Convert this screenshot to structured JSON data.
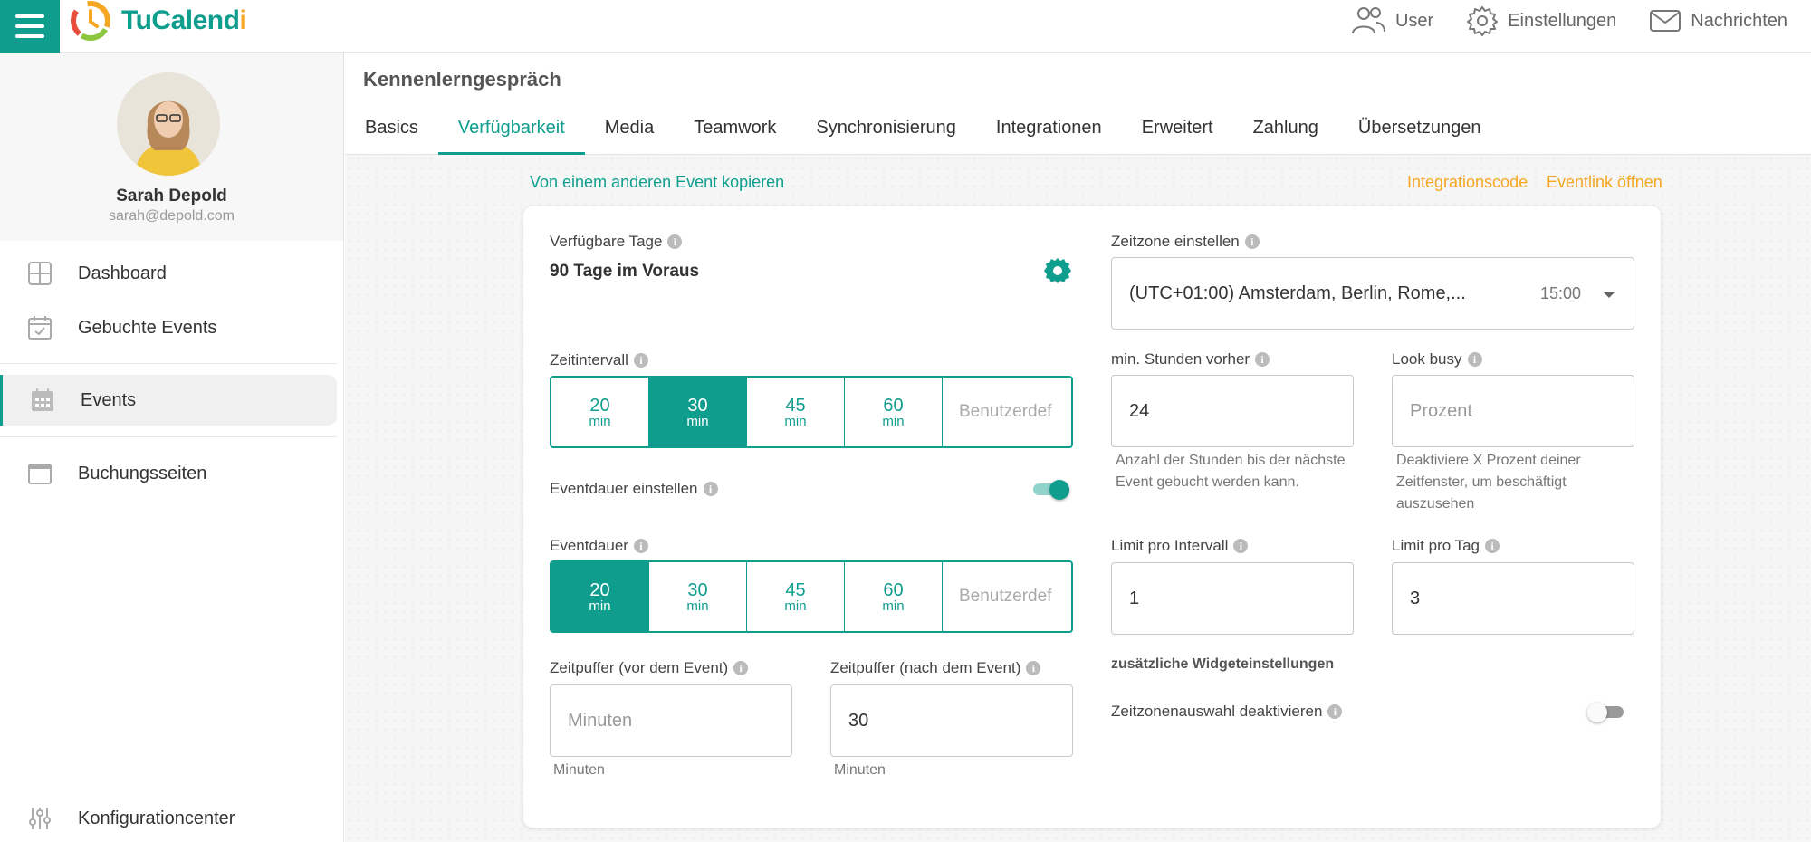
{
  "brand": {
    "name_part1": "TuCal",
    "name_part2": "end",
    "name_part3": "i"
  },
  "top_nav": {
    "user": "User",
    "settings": "Einstellungen",
    "messages": "Nachrichten"
  },
  "profile": {
    "name": "Sarah Depold",
    "email": "sarah@depold.com"
  },
  "sidebar": {
    "items": [
      {
        "label": "Dashboard"
      },
      {
        "label": "Gebuchte Events"
      },
      {
        "label": "Events"
      },
      {
        "label": "Buchungsseiten"
      },
      {
        "label": "Konfigurationcenter"
      }
    ]
  },
  "event": {
    "title": "Kennenlerngespräch"
  },
  "tabs": [
    {
      "label": "Basics"
    },
    {
      "label": "Verfügbarkeit"
    },
    {
      "label": "Media"
    },
    {
      "label": "Teamwork"
    },
    {
      "label": "Synchronisierung"
    },
    {
      "label": "Integrationen"
    },
    {
      "label": "Erweitert"
    },
    {
      "label": "Zahlung"
    },
    {
      "label": "Übersetzungen"
    }
  ],
  "links": {
    "copy": "Von einem anderen Event kopieren",
    "integration_code": "Integrationscode",
    "open_event_link": "Eventlink öffnen"
  },
  "form": {
    "available_days": {
      "label": "Verfügbare Tage",
      "value": "90 Tage im Voraus"
    },
    "time_interval": {
      "label": "Zeitintervall",
      "options": [
        {
          "num": "20",
          "unit": "min"
        },
        {
          "num": "30",
          "unit": "min"
        },
        {
          "num": "45",
          "unit": "min"
        },
        {
          "num": "60",
          "unit": "min"
        }
      ],
      "custom_placeholder": "Benutzerdef"
    },
    "set_duration": {
      "label": "Eventdauer einstellen"
    },
    "duration": {
      "label": "Eventdauer",
      "options": [
        {
          "num": "20",
          "unit": "min"
        },
        {
          "num": "30",
          "unit": "min"
        },
        {
          "num": "45",
          "unit": "min"
        },
        {
          "num": "60",
          "unit": "min"
        }
      ],
      "custom_placeholder": "Benutzerdef"
    },
    "buffer_before": {
      "label": "Zeitpuffer (vor dem Event)",
      "placeholder": "Minuten",
      "helper": "Minuten"
    },
    "buffer_after": {
      "label": "Zeitpuffer (nach dem Event)",
      "value": "30",
      "helper": "Minuten"
    },
    "timezone": {
      "label": "Zeitzone einstellen",
      "value": "(UTC+01:00) Amsterdam, Berlin, Rome,...",
      "time": "15:00"
    },
    "min_hours": {
      "label": "min. Stunden vorher",
      "value": "24",
      "helper": "Anzahl der Stunden bis der nächste Event gebucht werden kann."
    },
    "look_busy": {
      "label": "Look busy",
      "placeholder": "Prozent",
      "helper": "Deaktiviere X Prozent deiner Zeitfenster, um beschäftigt auszusehen"
    },
    "limit_interval": {
      "label": "Limit pro Intervall",
      "value": "1"
    },
    "limit_day": {
      "label": "Limit pro Tag",
      "value": "3"
    },
    "widget_settings": {
      "label": "zusätzliche Widgeteinstellungen"
    },
    "disable_tz": {
      "label": "Zeitzonenauswahl deaktivieren"
    }
  },
  "colors": {
    "accent": "#0f9e8e",
    "orange": "#f5a623"
  }
}
